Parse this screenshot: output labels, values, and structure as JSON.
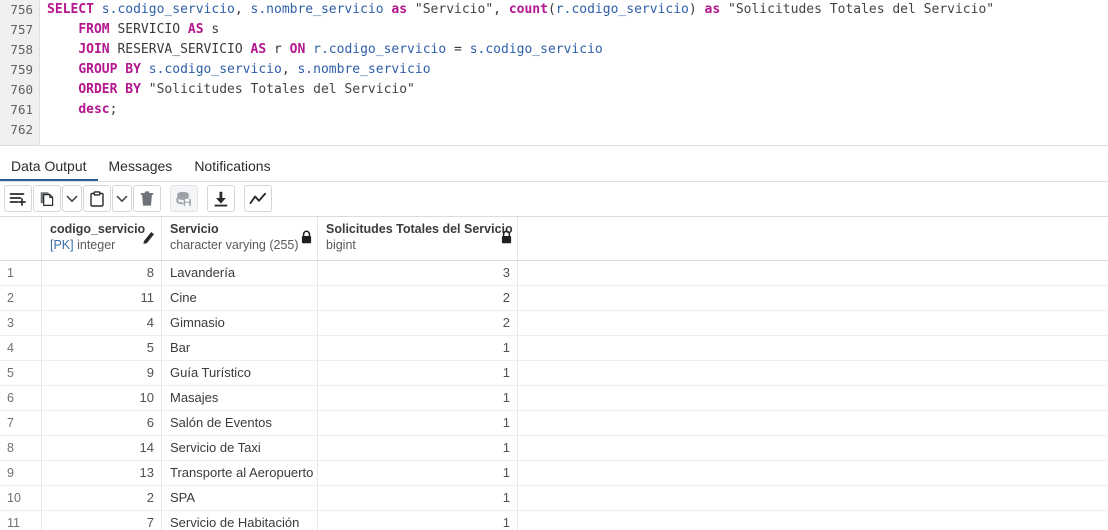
{
  "editor": {
    "line_numbers": [
      "756",
      "757",
      "758",
      "759",
      "760",
      "761",
      "762"
    ],
    "lines": [
      "SELECT s.codigo_servicio, s.nombre_servicio as \"Servicio\", count(r.codigo_servicio) as \"Solicitudes Totales del Servicio\"",
      "    FROM SERVICIO AS s",
      "    JOIN RESERVA_SERVICIO AS r ON r.codigo_servicio = s.codigo_servicio",
      "    GROUP BY s.codigo_servicio, s.nombre_servicio",
      "    ORDER BY \"Solicitudes Totales del Servicio\"",
      "    desc;",
      ""
    ],
    "tokens": [
      [
        [
          "SELECT",
          "kw"
        ],
        [
          " ",
          "plain"
        ],
        [
          "s.codigo_servicio",
          "ident"
        ],
        [
          ", ",
          "punc"
        ],
        [
          "s.nombre_servicio",
          "ident"
        ],
        [
          " ",
          "plain"
        ],
        [
          "as",
          "kw"
        ],
        [
          " ",
          "plain"
        ],
        [
          "\"Servicio\"",
          "str"
        ],
        [
          ", ",
          "punc"
        ],
        [
          "count",
          "fn"
        ],
        [
          "(",
          "punc"
        ],
        [
          "r.codigo_servicio",
          "ident"
        ],
        [
          ")",
          "punc"
        ],
        [
          " ",
          "plain"
        ],
        [
          "as",
          "kw"
        ],
        [
          " ",
          "plain"
        ],
        [
          "\"Solicitudes Totales del Servicio\"",
          "str"
        ]
      ],
      [
        [
          "    ",
          "plain"
        ],
        [
          "FROM",
          "kw"
        ],
        [
          " SERVICIO ",
          "plain"
        ],
        [
          "AS",
          "kw"
        ],
        [
          " s",
          "plain"
        ]
      ],
      [
        [
          "    ",
          "plain"
        ],
        [
          "JOIN",
          "kw"
        ],
        [
          " RESERVA_SERVICIO ",
          "plain"
        ],
        [
          "AS",
          "kw"
        ],
        [
          " r ",
          "plain"
        ],
        [
          "ON",
          "kw"
        ],
        [
          " ",
          "plain"
        ],
        [
          "r.codigo_servicio",
          "ident"
        ],
        [
          " = ",
          "plain"
        ],
        [
          "s.codigo_servicio",
          "ident"
        ]
      ],
      [
        [
          "    ",
          "plain"
        ],
        [
          "GROUP",
          "kw"
        ],
        [
          " ",
          "plain"
        ],
        [
          "BY",
          "kw"
        ],
        [
          " ",
          "plain"
        ],
        [
          "s.codigo_servicio",
          "ident"
        ],
        [
          ", ",
          "punc"
        ],
        [
          "s.nombre_servicio",
          "ident"
        ]
      ],
      [
        [
          "    ",
          "plain"
        ],
        [
          "ORDER",
          "kw"
        ],
        [
          " ",
          "plain"
        ],
        [
          "BY",
          "kw"
        ],
        [
          " ",
          "plain"
        ],
        [
          "\"Solicitudes Totales del Servicio\"",
          "str"
        ]
      ],
      [
        [
          "    ",
          "plain"
        ],
        [
          "desc",
          "kw"
        ],
        [
          ";",
          "punc"
        ]
      ],
      []
    ]
  },
  "tabs": [
    {
      "label": "Data Output",
      "active": true
    },
    {
      "label": "Messages",
      "active": false
    },
    {
      "label": "Notifications",
      "active": false
    }
  ],
  "toolbar": {
    "buttons": [
      {
        "name": "add-row-icon",
        "label": "Add row",
        "kind": "icon",
        "disabled": false
      },
      {
        "name": "copy-icon",
        "label": "Copy",
        "kind": "icon",
        "disabled": false
      },
      {
        "name": "copy-options-chevron-down-icon",
        "label": "Copy options",
        "kind": "caret",
        "disabled": false
      },
      {
        "name": "paste-icon",
        "label": "Paste",
        "kind": "icon",
        "disabled": false
      },
      {
        "name": "paste-options-chevron-down-icon",
        "label": "Paste options",
        "kind": "caret",
        "disabled": false
      },
      {
        "name": "delete-row-icon",
        "label": "Delete row",
        "kind": "icon",
        "disabled": false
      },
      {
        "name": "save-data-changes-icon",
        "label": "Save data changes",
        "kind": "icon",
        "disabled": true
      },
      {
        "name": "download-results-icon",
        "label": "Download as CSV",
        "kind": "icon",
        "disabled": false
      },
      {
        "name": "graph-visualiser-icon",
        "label": "Graph visualiser",
        "kind": "icon",
        "disabled": false
      }
    ]
  },
  "grid": {
    "columns": [
      {
        "name": "",
        "type": "",
        "icon": ""
      },
      {
        "name": "codigo_servicio",
        "type_prefix": "[PK] ",
        "type": "integer",
        "icon": "pencil-icon"
      },
      {
        "name": "Servicio",
        "type_prefix": "",
        "type": "character varying (255)",
        "icon": "lock-icon"
      },
      {
        "name": "Solicitudes Totales del Servicio",
        "type_prefix": "",
        "type": "bigint",
        "icon": "lock-icon"
      }
    ],
    "rows": [
      {
        "n": "1",
        "codigo_servicio": "8",
        "servicio": "Lavandería",
        "solicitudes": "3"
      },
      {
        "n": "2",
        "codigo_servicio": "11",
        "servicio": "Cine",
        "solicitudes": "2"
      },
      {
        "n": "3",
        "codigo_servicio": "4",
        "servicio": "Gimnasio",
        "solicitudes": "2"
      },
      {
        "n": "4",
        "codigo_servicio": "5",
        "servicio": "Bar",
        "solicitudes": "1"
      },
      {
        "n": "5",
        "codigo_servicio": "9",
        "servicio": "Guía Turístico",
        "solicitudes": "1"
      },
      {
        "n": "6",
        "codigo_servicio": "10",
        "servicio": "Masajes",
        "solicitudes": "1"
      },
      {
        "n": "7",
        "codigo_servicio": "6",
        "servicio": "Salón de Eventos",
        "solicitudes": "1"
      },
      {
        "n": "8",
        "codigo_servicio": "14",
        "servicio": "Servicio de Taxi",
        "solicitudes": "1"
      },
      {
        "n": "9",
        "codigo_servicio": "13",
        "servicio": "Transporte al Aeropuerto",
        "solicitudes": "1"
      },
      {
        "n": "10",
        "codigo_servicio": "2",
        "servicio": "SPA",
        "solicitudes": "1"
      },
      {
        "n": "11",
        "codigo_servicio": "7",
        "servicio": "Servicio de Habitación",
        "solicitudes": "1"
      }
    ]
  },
  "colors": {
    "accent": "#2c5f9e",
    "keyword": "#b5158e",
    "identifier": "#2f5fa8",
    "gutter_bg": "#f0f0f0",
    "scrollbar_thumb": "#c9ccd6"
  }
}
